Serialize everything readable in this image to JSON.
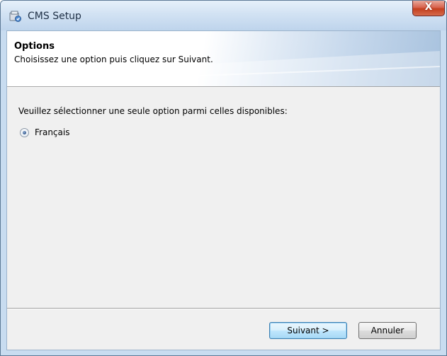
{
  "window": {
    "title": "CMS Setup",
    "close_glyph": "X",
    "icon": "setup-icon"
  },
  "banner": {
    "title": "Options",
    "subtitle": "Choisissez une option puis cliquez sur Suivant."
  },
  "content": {
    "instruction": "Veuillez sélectionner une seule option parmi celles disponibles:",
    "options": [
      {
        "label": "Français",
        "selected": true
      }
    ]
  },
  "buttons": {
    "next_label": "Suivant >",
    "cancel_label": "Annuler"
  },
  "colors": {
    "titlebar": "#c8dcf0",
    "close_button": "#c4401f",
    "default_button_border": "#3c7fb1",
    "radio_dot": "#3a5f93"
  }
}
